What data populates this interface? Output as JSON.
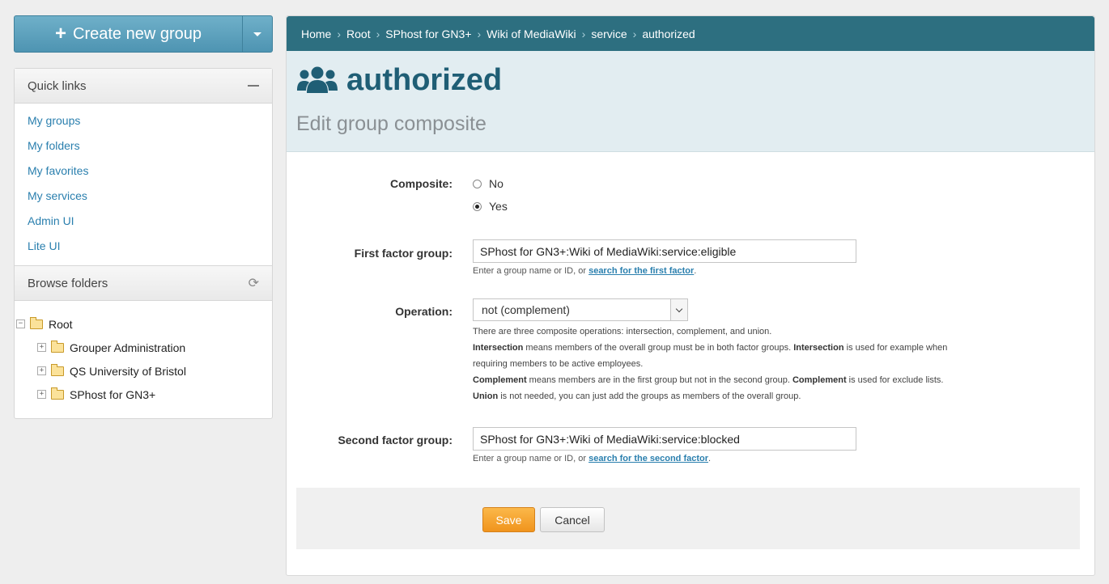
{
  "create_button": {
    "label": "Create new group"
  },
  "quick_links": {
    "title": "Quick links",
    "items": [
      "My groups",
      "My folders",
      "My favorites",
      "My services",
      "Admin UI",
      "Lite UI"
    ]
  },
  "browse_folders": {
    "title": "Browse folders",
    "root": "Root",
    "children": [
      "Grouper Administration",
      "QS University of Bristol",
      "SPhost for GN3+"
    ]
  },
  "breadcrumb": [
    "Home",
    "Root",
    "SPhost for GN3+",
    "Wiki of MediaWiki",
    "service",
    "authorized"
  ],
  "header": {
    "title": "authorized",
    "subtitle": "Edit group composite"
  },
  "form": {
    "composite": {
      "label": "Composite:",
      "options": [
        "No",
        "Yes"
      ],
      "selected": "Yes"
    },
    "first_factor": {
      "label": "First factor group:",
      "value": "SPhost for GN3+:Wiki of MediaWiki:service:eligible",
      "help_prefix": "Enter a group name or ID, or ",
      "help_link": "search for the first factor",
      "help_suffix": "."
    },
    "operation": {
      "label": "Operation:",
      "value": "not (complement)",
      "help_line1": "There are three composite operations: intersection, complement, and union.",
      "help_line2_b1": "Intersection",
      "help_line2_t1": " means members of the overall group must be in both factor groups. ",
      "help_line2_b2": "Intersection",
      "help_line2_t2": " is used for example when",
      "help_line3": "requiring members to be active employees.",
      "help_line4_b1": "Complement",
      "help_line4_t1": " means members are in the first group but not in the second group. ",
      "help_line4_b2": "Complement",
      "help_line4_t2": " is used for exclude lists.",
      "help_line5_b1": "Union",
      "help_line5_t1": " is not needed, you can just add the groups as members of the overall group."
    },
    "second_factor": {
      "label": "Second factor group:",
      "value": "SPhost for GN3+:Wiki of MediaWiki:service:blocked",
      "help_prefix": "Enter a group name or ID, or ",
      "help_link": "search for the second factor",
      "help_suffix": "."
    }
  },
  "buttons": {
    "save": "Save",
    "cancel": "Cancel"
  },
  "colors": {
    "brand": "#2d6f80",
    "accent": "#f0941d",
    "link": "#2a7fae"
  }
}
